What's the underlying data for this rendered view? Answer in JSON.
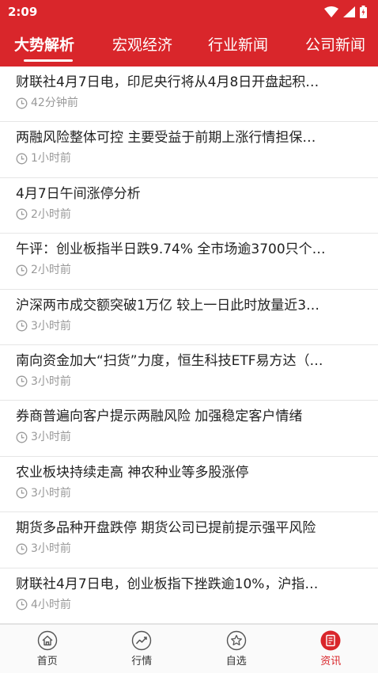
{
  "status_bar": {
    "time": "2:09"
  },
  "tabs": [
    {
      "label": "大势解析",
      "active": true
    },
    {
      "label": "宏观经济",
      "active": false
    },
    {
      "label": "行业新闻",
      "active": false
    },
    {
      "label": "公司新闻",
      "active": false
    }
  ],
  "news": [
    {
      "title": "财联社4月7日电，印尼央行将从4月8日开盘起积…",
      "time": "42分钟前"
    },
    {
      "title": "两融风险整体可控 主要受益于前期上涨行情担保…",
      "time": "1小时前"
    },
    {
      "title": "4月7日午间涨停分析",
      "time": "2小时前"
    },
    {
      "title": "午评：创业板指半日跌9.74% 全市场逾3700只个…",
      "time": "2小时前"
    },
    {
      "title": "沪深两市成交额突破1万亿 较上一日此时放量近3…",
      "time": "3小时前"
    },
    {
      "title": "南向资金加大“扫货”力度，恒生科技ETF易方达（…",
      "time": "3小时前"
    },
    {
      "title": "券商普遍向客户提示两融风险 加强稳定客户情绪",
      "time": "3小时前"
    },
    {
      "title": "农业板块持续走高 神农种业等多股涨停",
      "time": "3小时前"
    },
    {
      "title": "期货多品种开盘跌停 期货公司已提前提示强平风险",
      "time": "3小时前"
    },
    {
      "title": "财联社4月7日电，创业板指下挫跌逾10%，沪指…",
      "time": "4小时前"
    }
  ],
  "bottom_nav": [
    {
      "label": "首页",
      "icon": "home-icon",
      "active": false
    },
    {
      "label": "行情",
      "icon": "trend-icon",
      "active": false
    },
    {
      "label": "自选",
      "icon": "star-icon",
      "active": false
    },
    {
      "label": "资讯",
      "icon": "news-icon",
      "active": true
    }
  ],
  "colors": {
    "brand_red": "#d9262b",
    "meta_gray": "#999999"
  }
}
